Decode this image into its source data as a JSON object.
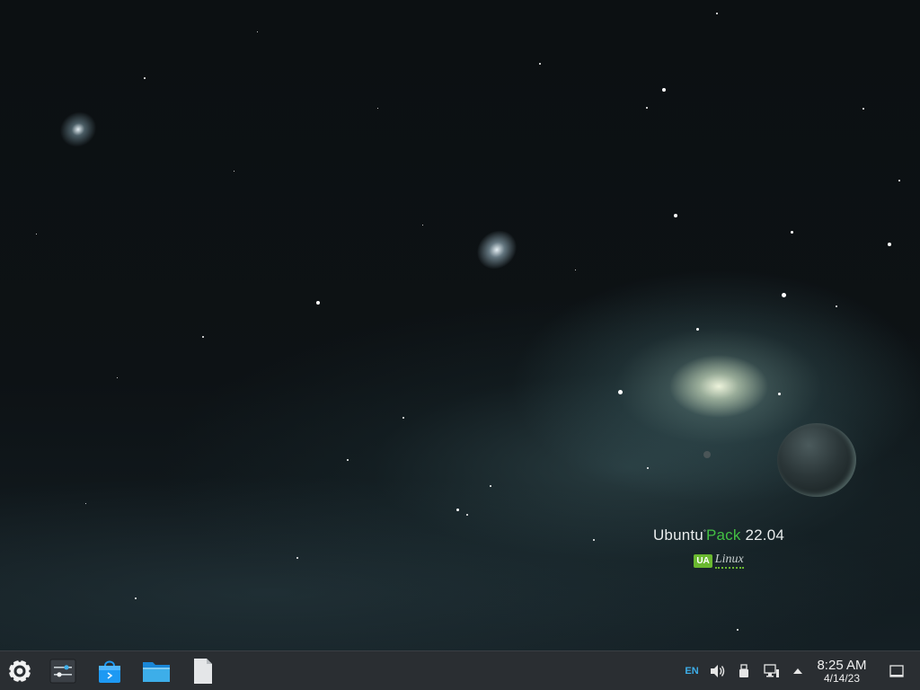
{
  "desktop": {
    "watermark": {
      "brand_part1": "Ubuntu",
      "brand_part2": "Pack",
      "version": "22.04",
      "badge": "UA",
      "linux": "Linux"
    }
  },
  "taskbar": {
    "launchers": [
      {
        "name": "application-launcher",
        "icon": "gear-menu-icon"
      },
      {
        "name": "system-settings",
        "icon": "sliders-icon"
      },
      {
        "name": "software-store",
        "icon": "shopping-bag-icon"
      },
      {
        "name": "file-manager",
        "icon": "folder-icon"
      },
      {
        "name": "text-editor",
        "icon": "document-icon"
      }
    ],
    "tray": {
      "keyboard_layout": "EN",
      "icons": [
        "volume-icon",
        "usb-icon",
        "network-icon",
        "chevron-up-icon"
      ]
    },
    "clock": {
      "time": "8:25 AM",
      "date": "4/14/23"
    }
  },
  "colors": {
    "taskbar_bg": "#2a2e32",
    "accent": "#3daee9",
    "brand_green": "#43c043"
  }
}
